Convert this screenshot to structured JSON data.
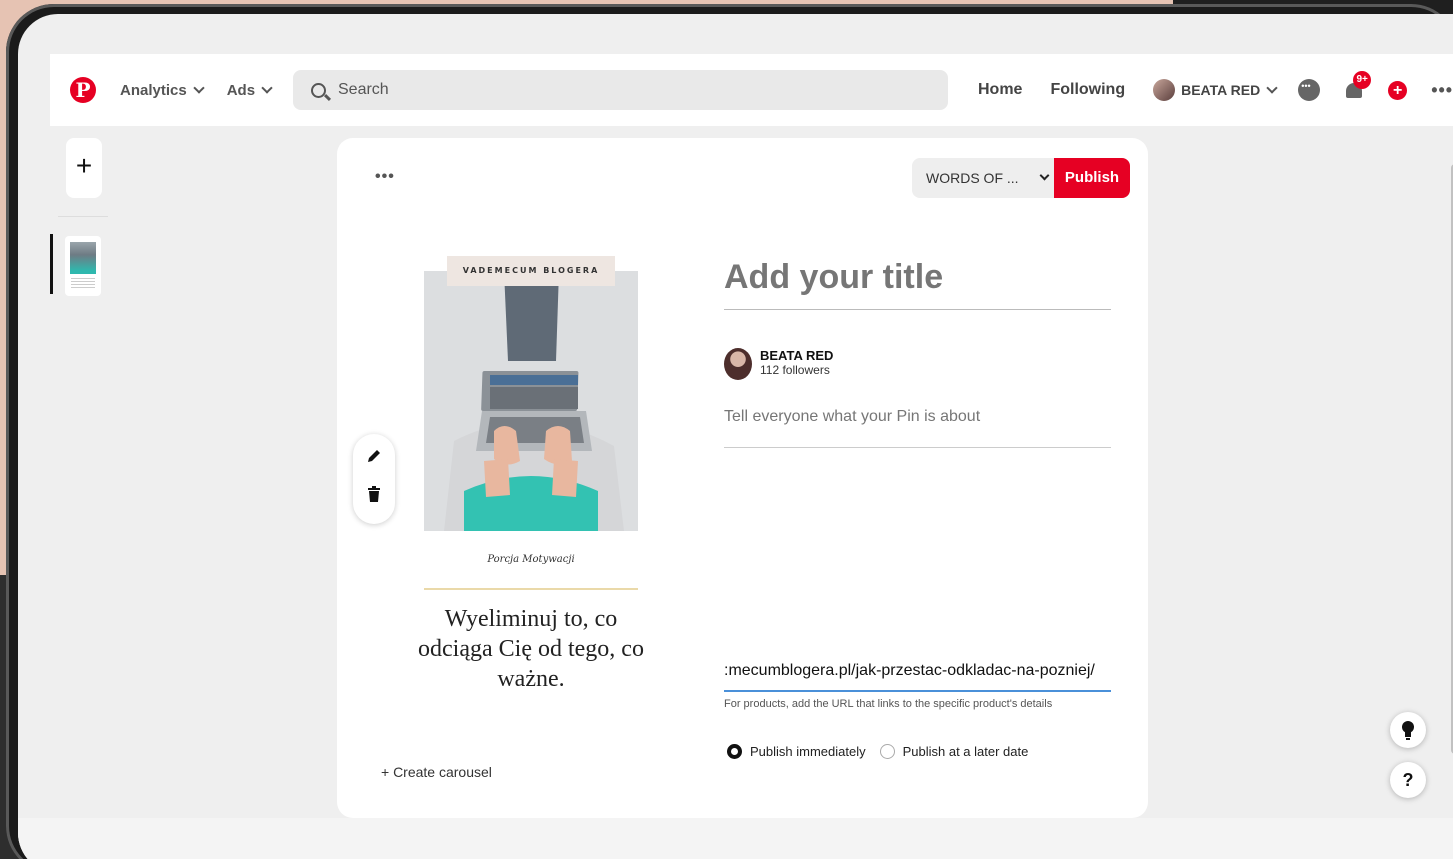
{
  "header": {
    "nav_left": [
      {
        "label": "Analytics"
      },
      {
        "label": "Ads"
      }
    ],
    "search_placeholder": "Search",
    "nav_right": [
      {
        "label": "Home"
      },
      {
        "label": "Following"
      }
    ],
    "profile_name": "BEATA RED",
    "notifications_badge": "9+"
  },
  "editor": {
    "board_select": "WORDS OF ...",
    "publish_label": "Publish",
    "create_carousel": "+ Create carousel",
    "title_placeholder": "Add your title",
    "author_name": "BEATA RED",
    "author_followers": "112 followers",
    "about_placeholder": "Tell everyone what your Pin is about",
    "url_value": ":mecumblogera.pl/jak-przestac-odkladac-na-pozniej/",
    "url_hint": "For products, add the URL that links to the specific product's details",
    "publish_options": [
      {
        "label": "Publish immediately",
        "selected": true
      },
      {
        "label": "Publish at a later date",
        "selected": false
      }
    ]
  },
  "pin_preview": {
    "header_text": "VADEMECUM BLOGERA",
    "caption": "Porcja Motywacji",
    "quote": "Wyeliminuj to, co odciąga Cię od tego, co ważne."
  },
  "colors": {
    "brand": "#e60023",
    "url_underline": "#4a90d9"
  },
  "icons": {
    "logo": "pinterest-logo-icon",
    "search": "search-icon",
    "chat": "chat-icon",
    "bell": "bell-icon",
    "create": "plus-circle-icon",
    "more": "more-icon",
    "edit": "pencil-icon",
    "delete": "trash-icon",
    "tips": "lightbulb-icon",
    "help": "question-icon"
  }
}
